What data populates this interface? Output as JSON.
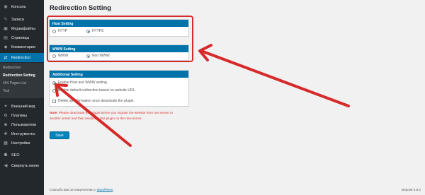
{
  "sidebar": {
    "items": [
      {
        "label": "Консоль",
        "icon": "dashboard-icon",
        "glyph": "◉"
      },
      {
        "label": "Записи",
        "icon": "pin-icon",
        "glyph": "✎"
      },
      {
        "label": "Медиафайлы",
        "icon": "media-icon",
        "glyph": "▣"
      },
      {
        "label": "Страницы",
        "icon": "page-icon",
        "glyph": "▤"
      },
      {
        "label": "Комментарии",
        "icon": "comment-icon",
        "glyph": "◆"
      },
      {
        "label": "Redirection",
        "icon": "redirect-icon",
        "glyph": "⇄"
      }
    ],
    "submenu": [
      {
        "label": "Redirection"
      },
      {
        "label": "Redirection Setting"
      },
      {
        "label": "404 Pages List"
      },
      {
        "label": "Tool"
      }
    ],
    "lower_items": [
      {
        "label": "Внешний вид",
        "icon": "appearance-icon",
        "glyph": "✦"
      },
      {
        "label": "Плагины",
        "icon": "plugin-icon",
        "glyph": "⚙"
      },
      {
        "label": "Пользователи",
        "icon": "users-icon",
        "glyph": "☻"
      },
      {
        "label": "Инструменты",
        "icon": "tools-icon",
        "glyph": "✚"
      },
      {
        "label": "Настройки",
        "icon": "settings-icon",
        "glyph": "▦"
      },
      {
        "label": "SEO",
        "icon": "seo-icon",
        "glyph": "⚉"
      },
      {
        "label": "Свернуть меню",
        "icon": "collapse-icon",
        "glyph": "◀"
      }
    ]
  },
  "page": {
    "title": "Redirection Setting"
  },
  "host_setting": {
    "header": "Host Setting",
    "options": [
      {
        "label": "HTTP",
        "checked": false
      },
      {
        "label": "HTTPS",
        "checked": true
      }
    ]
  },
  "www_setting": {
    "header": "WWW Setting",
    "options": [
      {
        "label": "WWW",
        "checked": false
      },
      {
        "label": "Non WWW",
        "checked": true
      }
    ]
  },
  "additional_setting": {
    "header": "Additional Setting",
    "options": [
      {
        "label": "Enable Host and WWW setting.",
        "checked": true
      },
      {
        "label": "Enable default redirection based on website URL.",
        "checked": false
      }
    ],
    "checkbox_label": "Delete all information once deactivate the plugin."
  },
  "note": {
    "prefix": "Note:",
    "line1": "Please deactivate this plugin before you migrate the website from one server to",
    "line2": "another server and then reactivate this plugin on the new server."
  },
  "save_label": "Save",
  "footer": {
    "left_text": "Спасибо вам за творчество с",
    "left_link": "WordPress",
    "left_suffix": ".",
    "version": "Версия 3.9.2"
  },
  "colors": {
    "accent": "#0073aa",
    "sidebar": "#23282d",
    "annotation": "#d62a2a",
    "note": "#dc3232"
  }
}
